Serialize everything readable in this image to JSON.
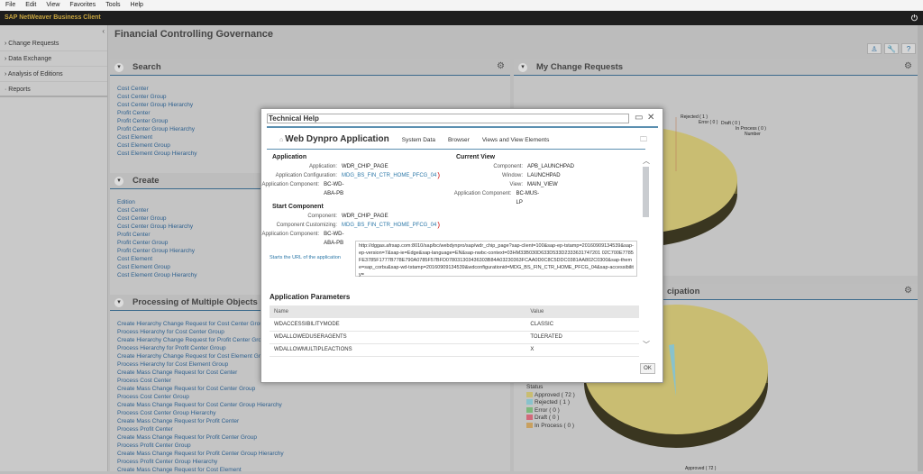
{
  "menu": [
    "File",
    "Edit",
    "View",
    "Favorites",
    "Tools",
    "Help"
  ],
  "app_title": "SAP NetWeaver Business Client",
  "sidebar": {
    "items": [
      {
        "label": "Change Requests",
        "icon": "chevron-right"
      },
      {
        "label": "Data Exchange",
        "icon": "chevron-right"
      },
      {
        "label": "Analysis of Editions",
        "icon": "chevron-right"
      },
      {
        "label": "Reports",
        "icon": "bullet"
      }
    ]
  },
  "page_title": "Financial Controlling Governance",
  "search": {
    "title": "Search",
    "links": [
      "Cost Center",
      "Cost Center Group",
      "Cost Center Group Hierarchy",
      "Profit Center",
      "Profit Center Group",
      "Profit Center Group Hierarchy",
      "Cost Element",
      "Cost Element Group",
      "Cost Element Group Hierarchy"
    ]
  },
  "create": {
    "title": "Create",
    "links": [
      "Edition",
      "Cost Center",
      "Cost Center Group",
      "Cost Center Group Hierarchy",
      "Profit Center",
      "Profit Center Group",
      "Profit Center Group Hierarchy",
      "Cost Element",
      "Cost Element Group",
      "Cost Element Group Hierarchy"
    ]
  },
  "processing": {
    "title": "Processing of Multiple Objects",
    "links": [
      "Create Hierarchy Change Request for Cost Center Group",
      "Process Hierarchy for Cost Center Group",
      "Create Hierarchy Change Request for Profit Center Group",
      "Process Hierarchy for Profit Center Group",
      "Create Hierarchy Change Request for Cost Element Group",
      "Process Hierarchy for Cost Element Group",
      "Create Mass Change Request for Cost Center",
      "Process Cost Center",
      "Create Mass Change Request for Cost Center Group",
      "Process Cost Center Group",
      "Create Mass Change Request for Cost Center Group Hierarchy",
      "Process Cost Center Group Hierarchy",
      "Create Mass Change Request for Profit Center",
      "Process Profit Center",
      "Create Mass Change Request for Profit Center Group",
      "Process Profit Center Group",
      "Create Mass Change Request for Profit Center Group Hierarchy",
      "Process Profit Center Group Hierarchy",
      "Create Mass Change Request for Cost Element"
    ]
  },
  "my_change_requests": {
    "title": "My Change Requests",
    "labels": [
      "Rejected ( 1 )",
      "Error ( 0 )",
      "Draft ( 0 )",
      "In Process ( 0 )",
      "Number"
    ]
  },
  "participation": {
    "title_visible": "cipation",
    "legend_title": "Status",
    "bottom_label": "Approved ( 72 )"
  },
  "chart_data": {
    "type": "pie",
    "title": "",
    "legend_title": "Status",
    "categories": [
      "Approved",
      "Rejected",
      "Error",
      "Draft",
      "In Process"
    ],
    "values": [
      72,
      1,
      0,
      0,
      0
    ],
    "colors": [
      "#c9bd72",
      "#88c2cc",
      "#7cb87c",
      "#d2697a",
      "#c8a060"
    ],
    "legend_labels": [
      "Approved ( 72 )",
      "Rejected ( 1 )",
      "Error ( 0 )",
      "Draft ( 0 )",
      "In Process ( 0 )"
    ]
  },
  "modal": {
    "title": "Technical Help",
    "tabs": [
      "Web Dynpro Application",
      "System Data",
      "Browser",
      "Views and View Elements"
    ],
    "application": {
      "heading": "Application",
      "rows": [
        [
          "Application:",
          "WDR_CHIP_PAGE"
        ],
        [
          "Application Configuration:",
          "MDG_BS_FIN_CTR_HOME_PFCG_04"
        ],
        [
          "Application Component:",
          "BC-WD-ABA-PB"
        ]
      ]
    },
    "current_view": {
      "heading": "Current View",
      "rows": [
        [
          "Component:",
          "APB_LAUNCHPAD"
        ],
        [
          "Window:",
          "LAUNCHPAD"
        ],
        [
          "View:",
          "MAIN_VIEW"
        ],
        [
          "Application Component:",
          "BC-MUS-LP"
        ]
      ]
    },
    "start_component": {
      "heading": "Start Component",
      "rows": [
        [
          "Component:",
          "WDR_CHIP_PAGE"
        ],
        [
          "Component Customizing:",
          "MDG_BS_FIN_CTR_HOME_PFCG_04"
        ],
        [
          "Application Component:",
          "BC-WD-ABA-PB"
        ]
      ]
    },
    "url_label": "Starts the URL of the application",
    "url": "http://dggas.afrsap.com:8010/sap/bc/webdynpro/sap/wdr_chip_page?sap-client=100&sap-ep-tstamp=20160909134539&sap-ep-version=7&sap-ie=Edge&sap-language=EN&sap-nwbc-context=03HM33B030D633D533D2333631747201 02C700E7785FE3785F1777B778E790A0785F57BFD078031303436303B84A03230363FCAA0D0C8C5DDC0381AA802C0300&sap-theme=sap_corbu&sap-wd-tstamp=20160909134539&wdconfigurationid=MDG_BS_FIN_CTR_HOME_PFCG_04&sap-accessibility=",
    "params_title": "Application Parameters",
    "params_headers": [
      "Name",
      "Value"
    ],
    "params": [
      [
        "WDACCESSIBILITYMODE",
        "CLASSIC"
      ],
      [
        "WDALLOWEDUSERAGENTS",
        "TOLERATED"
      ],
      [
        "WDALLOWMULTIPLEACTIONS",
        "X"
      ]
    ],
    "ok": "OK"
  }
}
